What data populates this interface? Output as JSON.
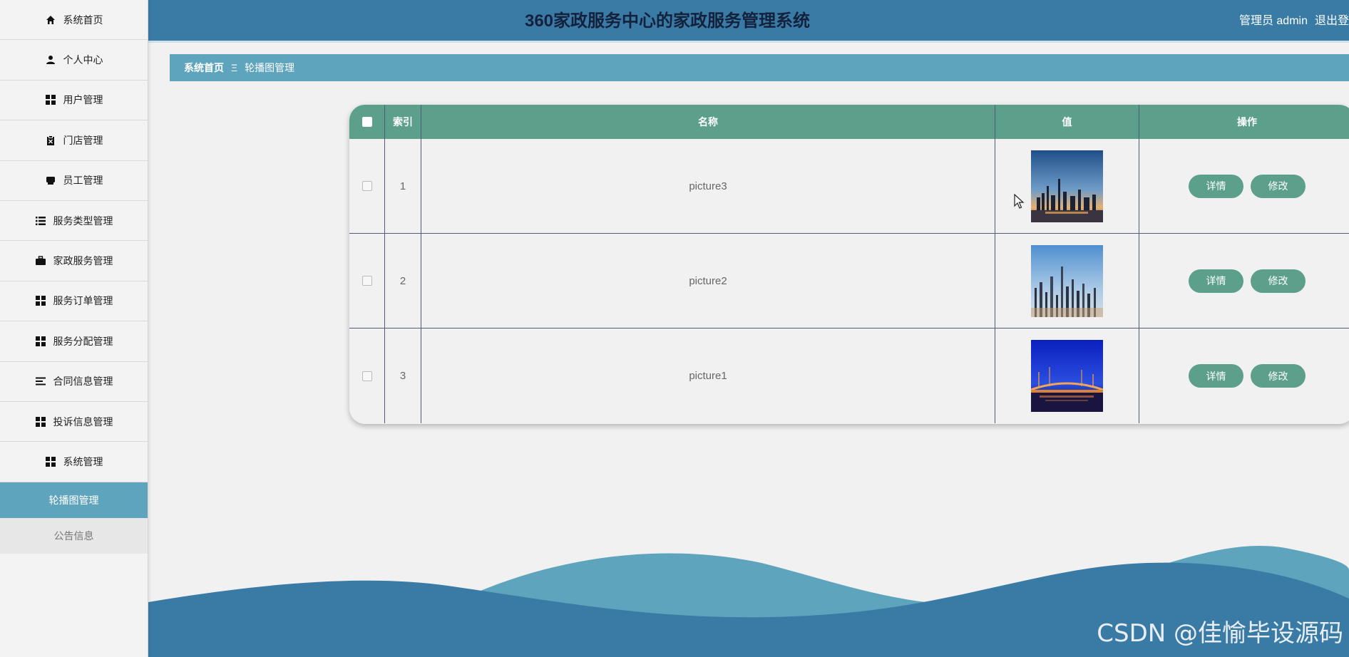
{
  "header": {
    "title": "360家政服务中心的家政服务管理系统",
    "user_label": "管理员 admin",
    "logout_label": "退出登"
  },
  "sidebar": {
    "items": [
      {
        "label": "系统首页",
        "icon": "home-icon"
      },
      {
        "label": "个人中心",
        "icon": "user-icon"
      },
      {
        "label": "用户管理",
        "icon": "grid-icon"
      },
      {
        "label": "门店管理",
        "icon": "clipboard-icon"
      },
      {
        "label": "员工管理",
        "icon": "printer-icon"
      },
      {
        "label": "服务类型管理",
        "icon": "list-icon"
      },
      {
        "label": "家政服务管理",
        "icon": "briefcase-icon"
      },
      {
        "label": "服务订单管理",
        "icon": "grid-icon"
      },
      {
        "label": "服务分配管理",
        "icon": "grid-icon"
      },
      {
        "label": "合同信息管理",
        "icon": "menu-icon"
      },
      {
        "label": "投诉信息管理",
        "icon": "grid-icon"
      },
      {
        "label": "系统管理",
        "icon": "grid-icon"
      }
    ],
    "sub_items": [
      {
        "label": "轮播图管理",
        "active": true
      },
      {
        "label": "公告信息",
        "active": false
      }
    ]
  },
  "breadcrumb": {
    "home": "系统首页",
    "separator": "Ξ",
    "current": "轮播图管理"
  },
  "table": {
    "columns": [
      "索引",
      "名称",
      "值",
      "操作"
    ],
    "rows": [
      {
        "index": "1",
        "name": "picture3",
        "image": "city-skyline-sunset"
      },
      {
        "index": "2",
        "name": "picture2",
        "image": "blurred-city-skyline"
      },
      {
        "index": "3",
        "name": "picture1",
        "image": "night-bridge-blue"
      }
    ],
    "detail_label": "详情",
    "edit_label": "修改"
  },
  "watermark": "CSDN @佳愉毕设源码",
  "colors": {
    "header_bg": "#3a7ba5",
    "breadcrumb_bg": "#5fa4bd",
    "table_header_bg": "#5c9f8b",
    "button_bg": "#5c9f8b",
    "sidebar_active_bg": "#5fa4bd"
  }
}
